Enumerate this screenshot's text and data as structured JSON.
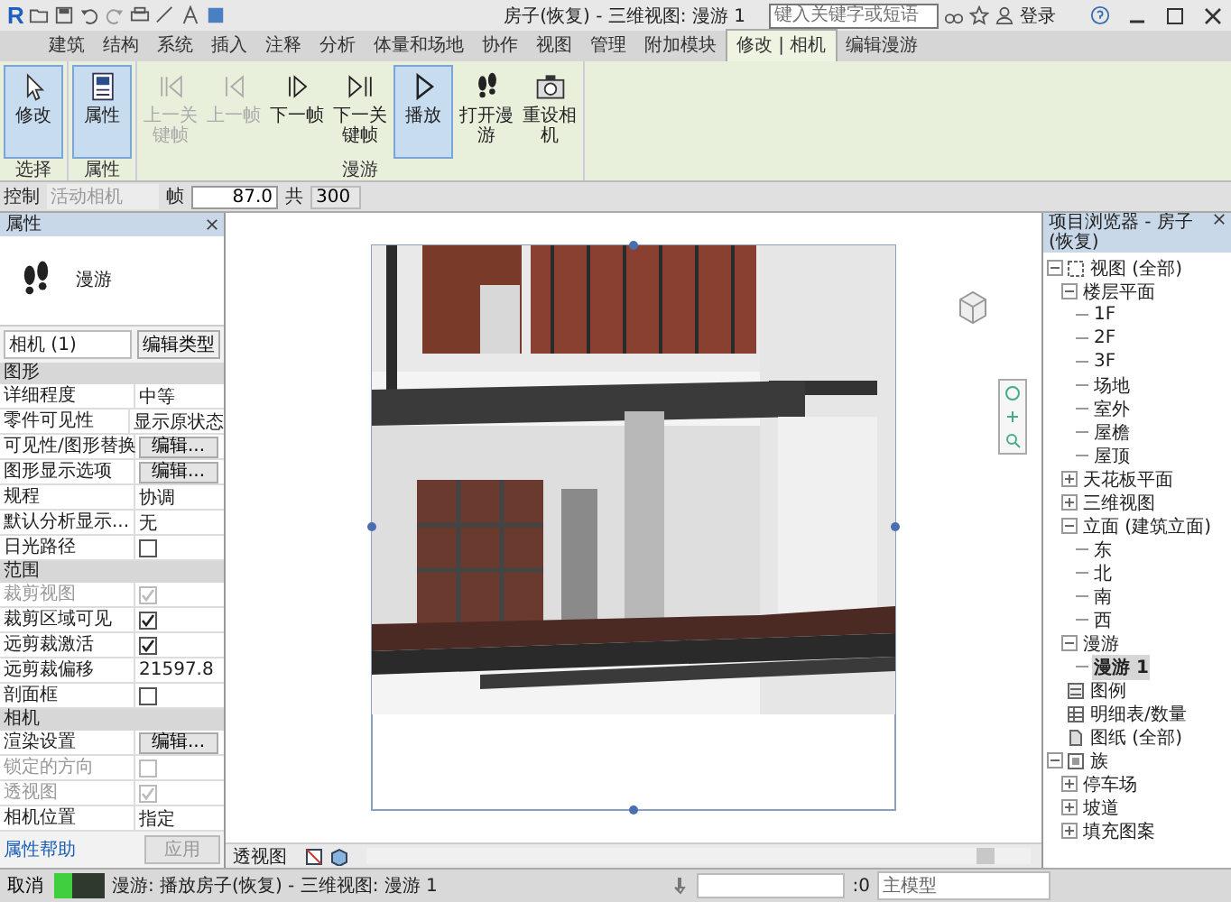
{
  "title_bar": {
    "logo": "R",
    "title": "房子(恢复) - 三维视图: 漫游 1",
    "search": {
      "placeholder": "键入关键字或短语"
    },
    "login": "登录"
  },
  "ribbon_tabs": [
    {
      "label": "建筑",
      "selected": false
    },
    {
      "label": "结构",
      "selected": false
    },
    {
      "label": "系统",
      "selected": false
    },
    {
      "label": "插入",
      "selected": false
    },
    {
      "label": "注释",
      "selected": false
    },
    {
      "label": "分析",
      "selected": false
    },
    {
      "label": "体量和场地",
      "selected": false
    },
    {
      "label": "协作",
      "selected": false
    },
    {
      "label": "视图",
      "selected": false
    },
    {
      "label": "管理",
      "selected": false
    },
    {
      "label": "附加模块",
      "selected": false
    },
    {
      "label": "修改 | 相机",
      "selected": true
    },
    {
      "label": "编辑漫游",
      "selected": false
    }
  ],
  "ribbon_panels": [
    {
      "label": "选择",
      "buttons": [
        {
          "kind": "cursor",
          "label": "修改",
          "selected": true,
          "disabled": false
        }
      ]
    },
    {
      "label": "属性",
      "buttons": [
        {
          "kind": "properties",
          "label": "属性",
          "selected": true,
          "disabled": false
        }
      ]
    },
    {
      "label": "漫游",
      "buttons": [
        {
          "kind": "prev-key",
          "label": "上一关键帧",
          "selected": false,
          "disabled": true
        },
        {
          "kind": "prev",
          "label": "上一帧",
          "selected": false,
          "disabled": true
        },
        {
          "kind": "next",
          "label": "下一帧",
          "selected": false,
          "disabled": false
        },
        {
          "kind": "next-key",
          "label": "下一关键帧",
          "selected": false,
          "disabled": false
        },
        {
          "kind": "play",
          "label": "播放",
          "selected": true,
          "disabled": false
        },
        {
          "kind": "footprints",
          "label": "打开漫游",
          "selected": false,
          "disabled": false
        },
        {
          "kind": "camera",
          "label": "重设相机",
          "selected": false,
          "disabled": false
        }
      ]
    }
  ],
  "options_bar": {
    "control_label": "控制",
    "control_value": "活动相机",
    "frame_label": "帧",
    "frame_value": "87.0",
    "total_label": "共",
    "total_value": "300"
  },
  "properties": {
    "title": "属性",
    "type_name": "漫游",
    "instance": "相机 (1)",
    "edit_type": "编辑类型",
    "sections": [
      {
        "title": "图形",
        "rows": [
          {
            "kind": "text",
            "label": "详细程度",
            "value": "中等",
            "disabled": false
          },
          {
            "kind": "text",
            "label": "零件可见性",
            "value": "显示原状态",
            "disabled": false
          },
          {
            "kind": "button",
            "label": "可见性/图形替换",
            "value": "编辑...",
            "disabled": false
          },
          {
            "kind": "button",
            "label": "图形显示选项",
            "value": "编辑...",
            "disabled": false
          },
          {
            "kind": "text",
            "label": "规程",
            "value": "协调",
            "disabled": false
          },
          {
            "kind": "text",
            "label": "默认分析显示...",
            "value": "无",
            "disabled": false
          },
          {
            "kind": "checkbox",
            "label": "日光路径",
            "checked": false,
            "disabled": false
          }
        ]
      },
      {
        "title": "范围",
        "rows": [
          {
            "kind": "checkbox",
            "label": "裁剪视图",
            "checked": true,
            "disabled": true
          },
          {
            "kind": "checkbox",
            "label": "裁剪区域可见",
            "checked": true,
            "disabled": false
          },
          {
            "kind": "checkbox",
            "label": "远剪裁激活",
            "checked": true,
            "disabled": false
          },
          {
            "kind": "text",
            "label": "远剪裁偏移",
            "value": "21597.8",
            "disabled": false
          },
          {
            "kind": "checkbox",
            "label": "剖面框",
            "checked": false,
            "disabled": false
          }
        ]
      },
      {
        "title": "相机",
        "rows": [
          {
            "kind": "button",
            "label": "渲染设置",
            "value": "编辑...",
            "disabled": false
          },
          {
            "kind": "checkbox",
            "label": "锁定的方向",
            "checked": false,
            "disabled": true
          },
          {
            "kind": "checkbox",
            "label": "透视图",
            "checked": true,
            "disabled": true
          },
          {
            "kind": "text",
            "label": "相机位置",
            "value": "指定",
            "disabled": false
          }
        ]
      }
    ],
    "help_link": "属性帮助",
    "apply": "应用"
  },
  "browser": {
    "title": "项目浏览器 - 房子(恢复)",
    "tree": [
      {
        "kind": "views",
        "label": "视图 (全部)",
        "expanded": true,
        "selected": false,
        "children": [
          {
            "kind": "group",
            "label": "楼层平面",
            "expanded": true,
            "selected": false,
            "children": [
              {
                "kind": "item",
                "label": "1F",
                "selected": false
              },
              {
                "kind": "item",
                "label": "2F",
                "selected": false
              },
              {
                "kind": "item",
                "label": "3F",
                "selected": false
              },
              {
                "kind": "item",
                "label": "场地",
                "selected": false
              },
              {
                "kind": "item",
                "label": "室外",
                "selected": false
              },
              {
                "kind": "item",
                "label": "屋檐",
                "selected": false
              },
              {
                "kind": "item",
                "label": "屋顶",
                "selected": false
              }
            ]
          },
          {
            "kind": "group",
            "label": "天花板平面",
            "expanded": false,
            "selected": false
          },
          {
            "kind": "group",
            "label": "三维视图",
            "expanded": false,
            "selected": false
          },
          {
            "kind": "group",
            "label": "立面 (建筑立面)",
            "expanded": true,
            "selected": false,
            "children": [
              {
                "kind": "item",
                "label": "东",
                "selected": false
              },
              {
                "kind": "item",
                "label": "北",
                "selected": false
              },
              {
                "kind": "item",
                "label": "南",
                "selected": false
              },
              {
                "kind": "item",
                "label": "西",
                "selected": false
              }
            ]
          },
          {
            "kind": "group",
            "label": "漫游",
            "expanded": true,
            "selected": false,
            "children": [
              {
                "kind": "item",
                "label": "漫游 1",
                "selected": true
              }
            ]
          }
        ]
      },
      {
        "kind": "legend",
        "label": "图例",
        "selected": false
      },
      {
        "kind": "schedule",
        "label": "明细表/数量",
        "selected": false
      },
      {
        "kind": "sheet",
        "label": "图纸 (全部)",
        "selected": false
      },
      {
        "kind": "family",
        "label": "族",
        "expanded": true,
        "selected": false,
        "children": [
          {
            "kind": "group",
            "label": "停车场",
            "expanded": false,
            "selected": false
          },
          {
            "kind": "group",
            "label": "坡道",
            "expanded": false,
            "selected": false
          },
          {
            "kind": "group",
            "label": "填充图案",
            "expanded": false,
            "selected": false
          }
        ]
      }
    ]
  },
  "view_bar": {
    "label": "透视图"
  },
  "status_bar": {
    "cancel": "取消",
    "progress": {
      "level": 0.35
    },
    "message": "漫游: 播放房子(恢复) - 三维视图: 漫游 1",
    "count": ":0",
    "model": "主模型"
  }
}
